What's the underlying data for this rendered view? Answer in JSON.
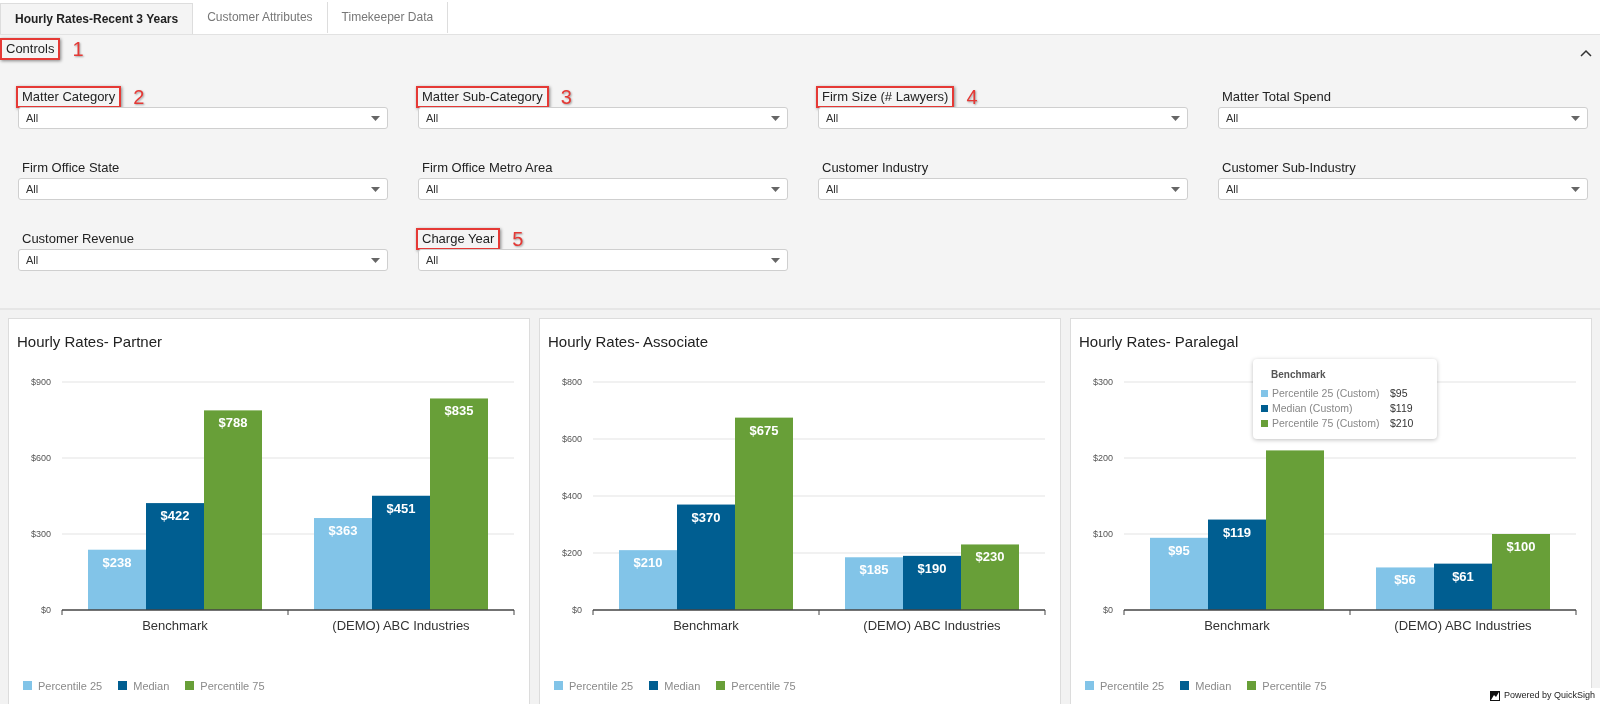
{
  "tabs": [
    {
      "label": "Hourly Rates-Recent 3 Years",
      "selected": true
    },
    {
      "label": "Customer Attributes",
      "selected": false
    },
    {
      "label": "Timekeeper Data",
      "selected": false
    }
  ],
  "controls": {
    "title": "Controls",
    "highlighted": true,
    "callout": "1",
    "expanded": true
  },
  "filters": [
    {
      "label": "Matter Category",
      "value": "All",
      "highlighted": true,
      "callout": "2"
    },
    {
      "label": "Matter Sub-Category",
      "value": "All",
      "highlighted": true,
      "callout": "3"
    },
    {
      "label": "Firm Size (# Lawyers)",
      "value": "All",
      "highlighted": true,
      "callout": "4"
    },
    {
      "label": "Matter Total Spend",
      "value": "All",
      "highlighted": false
    },
    {
      "label": "Firm Office State",
      "value": "All",
      "highlighted": false
    },
    {
      "label": "Firm Office Metro Area",
      "value": "All",
      "highlighted": false
    },
    {
      "label": "Customer Industry",
      "value": "All",
      "highlighted": false
    },
    {
      "label": "Customer Sub-Industry",
      "value": "All",
      "highlighted": false
    },
    {
      "label": "Customer Revenue",
      "value": "All",
      "highlighted": false
    },
    {
      "label": "Charge Year",
      "value": "All",
      "highlighted": true,
      "callout": "5"
    }
  ],
  "charts": [
    {
      "title": "Hourly Rates- Partner",
      "chart_data": {
        "type": "bar",
        "legend": "bottom",
        "grid": true,
        "categories": [
          "Benchmark",
          "(DEMO) ABC Industries"
        ],
        "ylim": [
          0,
          900
        ],
        "yticks": [
          {
            "value": 0,
            "label": "$0"
          },
          {
            "value": 300,
            "label": "$300"
          },
          {
            "value": 600,
            "label": "$600"
          },
          {
            "value": 900,
            "label": "$900"
          }
        ],
        "series": [
          {
            "name": "Percentile 25",
            "color": "#82c4e8",
            "values": [
              238,
              363
            ],
            "value_labels": [
              "$238",
              "$363"
            ]
          },
          {
            "name": "Median",
            "color": "#005e91",
            "values": [
              422,
              451
            ],
            "value_labels": [
              "$422",
              "$451"
            ]
          },
          {
            "name": "Percentile 75",
            "color": "#689f38",
            "values": [
              788,
              835
            ],
            "value_labels": [
              "$788",
              "$835"
            ]
          }
        ]
      }
    },
    {
      "title": "Hourly Rates- Associate",
      "chart_data": {
        "type": "bar",
        "legend": "bottom",
        "grid": true,
        "categories": [
          "Benchmark",
          "(DEMO) ABC Industries"
        ],
        "ylim": [
          0,
          800
        ],
        "yticks": [
          {
            "value": 0,
            "label": "$0"
          },
          {
            "value": 200,
            "label": "$200"
          },
          {
            "value": 400,
            "label": "$400"
          },
          {
            "value": 600,
            "label": "$600"
          },
          {
            "value": 800,
            "label": "$800"
          }
        ],
        "series": [
          {
            "name": "Percentile 25",
            "color": "#82c4e8",
            "values": [
              210,
              185
            ],
            "value_labels": [
              "$210",
              "$185"
            ]
          },
          {
            "name": "Median",
            "color": "#005e91",
            "values": [
              370,
              190
            ],
            "value_labels": [
              "$370",
              "$190"
            ]
          },
          {
            "name": "Percentile 75",
            "color": "#689f38",
            "values": [
              675,
              230
            ],
            "value_labels": [
              "$675",
              "$230"
            ]
          }
        ]
      }
    },
    {
      "title": "Hourly Rates- Paralegal",
      "chart_data": {
        "type": "bar",
        "legend": "bottom",
        "grid": true,
        "categories": [
          "Benchmark",
          "(DEMO) ABC Industries"
        ],
        "ylim": [
          0,
          300
        ],
        "yticks": [
          {
            "value": 0,
            "label": "$0"
          },
          {
            "value": 100,
            "label": "$100"
          },
          {
            "value": 200,
            "label": "$200"
          },
          {
            "value": 300,
            "label": "$300"
          }
        ],
        "series": [
          {
            "name": "Percentile 25",
            "color": "#82c4e8",
            "values": [
              95,
              56
            ],
            "value_labels": [
              "$95",
              "$56"
            ]
          },
          {
            "name": "Median",
            "color": "#005e91",
            "values": [
              119,
              61
            ],
            "value_labels": [
              "$119",
              "$61"
            ]
          },
          {
            "name": "Percentile 75",
            "color": "#689f38",
            "values": [
              210,
              100
            ],
            "value_labels": [
              null,
              "$100"
            ]
          }
        ]
      },
      "tooltip": {
        "title": "Benchmark",
        "rows": [
          {
            "label": "Percentile 25 (Custom)",
            "value": "$95",
            "color": "#82c4e8"
          },
          {
            "label": "Median (Custom)",
            "value": "$119",
            "color": "#005e91"
          },
          {
            "label": "Percentile 75 (Custom)",
            "value": "$210",
            "color": "#689f38"
          }
        ]
      }
    }
  ],
  "footer": {
    "text": "Powered by QuickSigh"
  }
}
